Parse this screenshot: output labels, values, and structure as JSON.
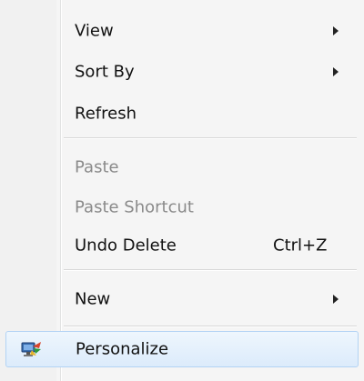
{
  "menu": {
    "view": "View",
    "sort_by": "Sort By",
    "refresh": "Refresh",
    "paste": "Paste",
    "paste_shortcut": "Paste Shortcut",
    "undo_delete": "Undo Delete",
    "undo_delete_shortcut": "Ctrl+Z",
    "new": "New",
    "personalize": "Personalize",
    "personalize_icon": "personalize-display-icon"
  }
}
